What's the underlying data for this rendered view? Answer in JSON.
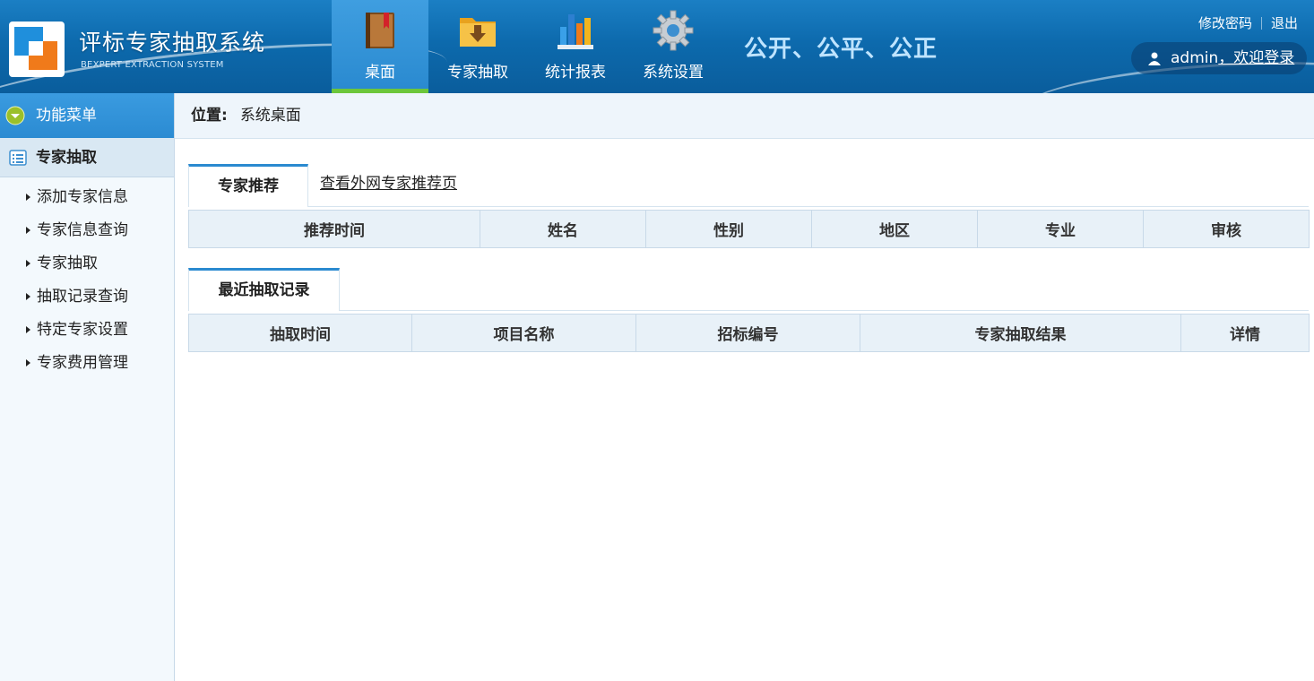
{
  "header": {
    "title": "评标专家抽取系统",
    "subtitle": "BEXPERT EXTRACTION SYSTEM",
    "slogan": "公开、公平、公正",
    "nav": [
      {
        "label": "桌面",
        "icon": "book-icon",
        "active": true
      },
      {
        "label": "专家抽取",
        "icon": "folder-download-icon",
        "active": false
      },
      {
        "label": "统计报表",
        "icon": "bar-chart-icon",
        "active": false
      },
      {
        "label": "系统设置",
        "icon": "gear-icon",
        "active": false
      }
    ],
    "links": {
      "change_password": "修改密码",
      "logout": "退出"
    },
    "user": {
      "name": "admin",
      "greeting": "，欢迎登录"
    }
  },
  "sidebar": {
    "menu_title": "功能菜单",
    "section_title": "专家抽取",
    "items": [
      "添加专家信息",
      "专家信息查询",
      "专家抽取",
      "抽取记录查询",
      "特定专家设置",
      "专家费用管理"
    ]
  },
  "breadcrumb": {
    "label": "位置:",
    "current": "系统桌面"
  },
  "recommend": {
    "tab": "专家推荐",
    "link": "查看外网专家推荐页",
    "columns": [
      "推荐时间",
      "姓名",
      "性别",
      "地区",
      "专业",
      "审核"
    ]
  },
  "records": {
    "tab": "最近抽取记录",
    "columns": [
      "抽取时间",
      "项目名称",
      "招标编号",
      "专家抽取结果",
      "详情"
    ]
  },
  "colors": {
    "header": "#0d6aad",
    "accent": "#2a8ad0",
    "active_underline": "#6cc63a",
    "slogan": "#bfe4ff"
  }
}
